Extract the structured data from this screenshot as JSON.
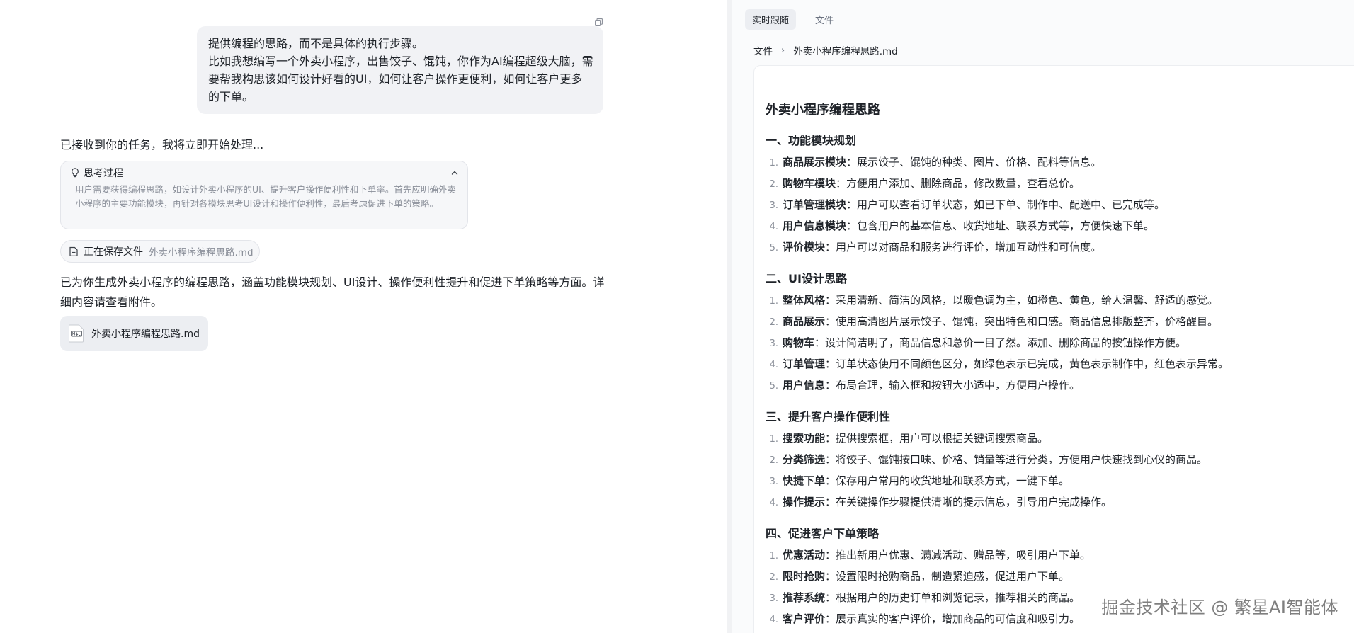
{
  "chat": {
    "user_message": {
      "line1": "提供编程的思路，而不是具体的执行步骤。",
      "line2": "比如我想编写一个外卖小程序，出售饺子、馄饨，你作为AI编程超级大脑，需要帮我构思该如何设计好看的UI，如何让客户操作更便利，如何让客户更多的下单。"
    },
    "ack_text": "已接收到你的任务，我将立即开始处理...",
    "thinking": {
      "title": "思考过程",
      "body": "用户需要获得编程思路，如设计外卖小程序的UI、提升客户操作便利性和下单率。首先应明确外卖小程序的主要功能模块，再针对各模块思考UI设计和操作便利性，最后考虑促进下单的策略。"
    },
    "saving": {
      "label": "正在保存文件",
      "file": "外卖小程序编程思路.md"
    },
    "result_text": "已为你生成外卖小程序的编程思路，涵盖功能模块规划、UI设计、操作便利性提升和促进下单策略等方面。详细内容请查看附件。",
    "attachment": {
      "name": "外卖小程序编程思路.md",
      "icon": "markdown-file-icon"
    }
  },
  "doc_panel": {
    "tabs": [
      {
        "label": "实时跟随",
        "active": true
      },
      {
        "label": "文件",
        "active": false
      }
    ],
    "breadcrumb": {
      "root": "文件",
      "current": "外卖小程序编程思路.md"
    },
    "title": "外卖小程序编程思路",
    "sections": [
      {
        "title": "一、功能模块规划",
        "items": [
          {
            "num": "1.",
            "term": "商品展示模块",
            "desc": "：展示饺子、馄饨的种类、图片、价格、配料等信息。"
          },
          {
            "num": "2.",
            "term": "购物车模块",
            "desc": "：方便用户添加、删除商品，修改数量，查看总价。"
          },
          {
            "num": "3.",
            "term": "订单管理模块",
            "desc": "：用户可以查看订单状态，如已下单、制作中、配送中、已完成等。"
          },
          {
            "num": "4.",
            "term": "用户信息模块",
            "desc": "：包含用户的基本信息、收货地址、联系方式等，方便快速下单。"
          },
          {
            "num": "5.",
            "term": "评价模块",
            "desc": "：用户可以对商品和服务进行评价，增加互动性和可信度。"
          }
        ]
      },
      {
        "title": "二、UI设计思路",
        "items": [
          {
            "num": "1.",
            "term": "整体风格",
            "desc": "：采用清新、简洁的风格，以暖色调为主，如橙色、黄色，给人温馨、舒适的感觉。"
          },
          {
            "num": "2.",
            "term": "商品展示",
            "desc": "：使用高清图片展示饺子、馄饨，突出特色和口感。商品信息排版整齐，价格醒目。"
          },
          {
            "num": "3.",
            "term": "购物车",
            "desc": "：设计简洁明了，商品信息和总价一目了然。添加、删除商品的按钮操作方便。"
          },
          {
            "num": "4.",
            "term": "订单管理",
            "desc": "：订单状态使用不同颜色区分，如绿色表示已完成，黄色表示制作中，红色表示异常。"
          },
          {
            "num": "5.",
            "term": "用户信息",
            "desc": "：布局合理，输入框和按钮大小适中，方便用户操作。"
          }
        ]
      },
      {
        "title": "三、提升客户操作便利性",
        "items": [
          {
            "num": "1.",
            "term": "搜索功能",
            "desc": "：提供搜索框，用户可以根据关键词搜索商品。"
          },
          {
            "num": "2.",
            "term": "分类筛选",
            "desc": "：将饺子、馄饨按口味、价格、销量等进行分类，方便用户快速找到心仪的商品。"
          },
          {
            "num": "3.",
            "term": "快捷下单",
            "desc": "：保存用户常用的收货地址和联系方式，一键下单。"
          },
          {
            "num": "4.",
            "term": "操作提示",
            "desc": "：在关键操作步骤提供清晰的提示信息，引导用户完成操作。"
          }
        ]
      },
      {
        "title": "四、促进客户下单策略",
        "items": [
          {
            "num": "1.",
            "term": "优惠活动",
            "desc": "：推出新用户优惠、满减活动、赠品等，吸引用户下单。"
          },
          {
            "num": "2.",
            "term": "限时抢购",
            "desc": "：设置限时抢购商品，制造紧迫感，促进用户下单。"
          },
          {
            "num": "3.",
            "term": "推荐系统",
            "desc": "：根据用户的历史订单和浏览记录，推荐相关的商品。"
          },
          {
            "num": "4.",
            "term": "客户评价",
            "desc": "：展示真实的客户评价，增加商品的可信度和吸引力。"
          }
        ]
      }
    ]
  },
  "watermark": "掘金技术社区 @ 繁星AI智能体"
}
